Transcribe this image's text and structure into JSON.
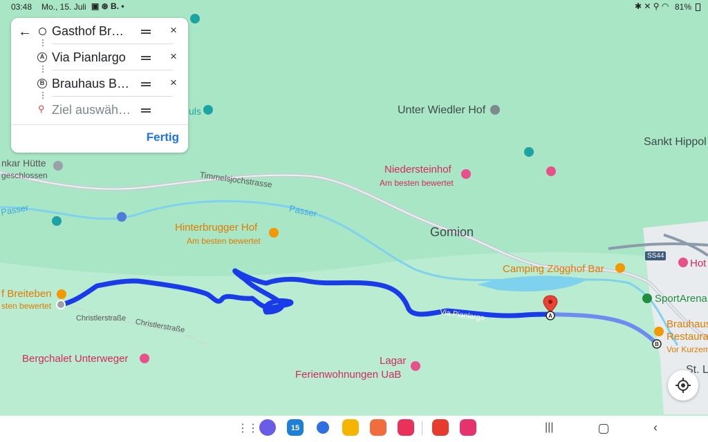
{
  "status_bar": {
    "time": "03:48",
    "date": "Mo., 15. Juli",
    "battery": "81%"
  },
  "directions": {
    "back_icon": "arrow-left-icon",
    "waypoints": [
      {
        "icon": "origin-circle-icon",
        "label": "Gasthof Br…",
        "removable": true,
        "placeholder": false
      },
      {
        "icon": "waypoint-a-icon",
        "marker": "A",
        "label": "Via Pianlargo",
        "removable": true,
        "placeholder": false
      },
      {
        "icon": "waypoint-b-icon",
        "marker": "B",
        "label": "Brauhaus B…",
        "removable": true,
        "placeholder": false
      },
      {
        "icon": "destination-pin-icon",
        "label": "Ziel auswäh…",
        "removable": false,
        "placeholder": true
      }
    ],
    "done_label": "Fertig"
  },
  "map": {
    "places": [
      {
        "name": "Unter Wiedler Hof",
        "type": "place"
      },
      {
        "name": "Sankt Hippol",
        "type": "place"
      },
      {
        "name": "Gomion",
        "type": "place"
      },
      {
        "name": "St. L",
        "type": "place"
      }
    ],
    "pois": [
      {
        "name": "Niedersteinhof",
        "sub": "Am besten bewertet",
        "kind": "hotel"
      },
      {
        "name": "Hinterbrugger Hof",
        "sub": "Am besten bewertet",
        "kind": "restaurant"
      },
      {
        "name": "Camping Zögghof Bar",
        "kind": "bar"
      },
      {
        "name": "SportArena",
        "kind": "sport"
      },
      {
        "name": "Hot",
        "kind": "hotel"
      },
      {
        "name": "Brauhaus",
        "kind": "restaurant"
      },
      {
        "name": "Restaura",
        "kind": "restaurant"
      },
      {
        "name": "Vor Kurzem",
        "kind": "note"
      },
      {
        "name": "f Breiteben",
        "sub": "sten bewertet",
        "kind": "restaurant"
      },
      {
        "name": "Bergchalet Unterweger",
        "kind": "hotel"
      },
      {
        "name": "Lagar",
        "sub": "Ferienwohnungen UaB",
        "kind": "hotel"
      },
      {
        "name": "nkar Hütte",
        "sub": "geschlossen",
        "kind": "hut"
      },
      {
        "name": "uls",
        "kind": "attraction"
      }
    ],
    "roads": [
      "Timmelsjochstrasse",
      "Christlerstraße",
      "Christlerstraße",
      "Via Pianlargo",
      "SS44"
    ],
    "waters": [
      "Passer",
      "Passer"
    ],
    "route_color": "#1a3be8",
    "locate_icon": "my-location-icon"
  },
  "nav_bar": {
    "apps": [
      "apps-grid-icon",
      "internet-app-icon",
      "calendar-app-icon",
      "messages-app-icon",
      "files-app-icon",
      "contacts-app-icon",
      "screen-recorder-icon",
      "notes-app-icon",
      "gallery-app-icon"
    ],
    "calendar_day": "15",
    "buttons": [
      "recents-button",
      "home-button",
      "back-button"
    ]
  }
}
